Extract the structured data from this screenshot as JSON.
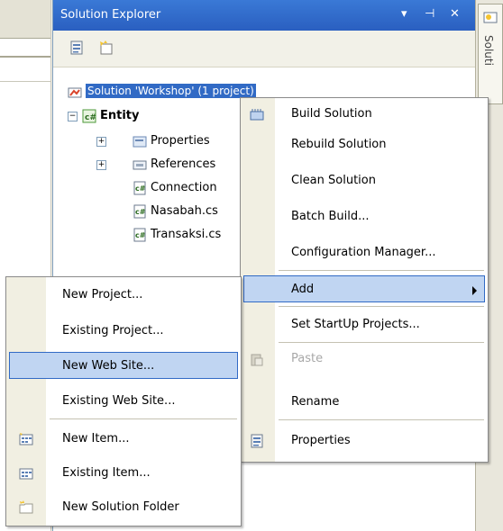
{
  "explorer": {
    "title": "Solution Explorer",
    "title_controls": [
      "▾",
      "⊣",
      "✕"
    ],
    "solution_label": "Solution 'Workshop' (1 project)",
    "project_label": "Entity",
    "items": [
      "Properties",
      "References",
      "Connection",
      "Nasabah.cs",
      "Transaksi.cs"
    ]
  },
  "side_tab": {
    "label": "Soluti"
  },
  "context_menu": {
    "items": [
      {
        "label": "Build Solution",
        "icon": "build-icon"
      },
      {
        "label": "Rebuild Solution"
      },
      {
        "label": "Clean Solution"
      },
      {
        "label": "Batch Build..."
      },
      {
        "label": "Configuration Manager..."
      },
      {
        "label": "Add",
        "highlighted": true,
        "submenu": true
      },
      {
        "label": "Set StartUp Projects..."
      },
      {
        "label": "Paste",
        "disabled": true,
        "icon": "paste-icon"
      },
      {
        "label": "Rename"
      },
      {
        "label": "Properties",
        "icon": "properties-icon"
      }
    ]
  },
  "submenu": {
    "items": [
      {
        "label": "New Project..."
      },
      {
        "label": "Existing Project..."
      },
      {
        "label": "New Web Site...",
        "highlighted": true
      },
      {
        "label": "Existing Web Site..."
      },
      {
        "label": "New Item...",
        "icon": "new-item-icon"
      },
      {
        "label": "Existing Item...",
        "icon": "existing-item-icon"
      },
      {
        "label": "New Solution Folder",
        "icon": "new-folder-icon"
      }
    ]
  },
  "colors": {
    "title_bar": "#2a5fc0",
    "highlight": "#c0d5f2",
    "highlight_border": "#316ac5"
  }
}
